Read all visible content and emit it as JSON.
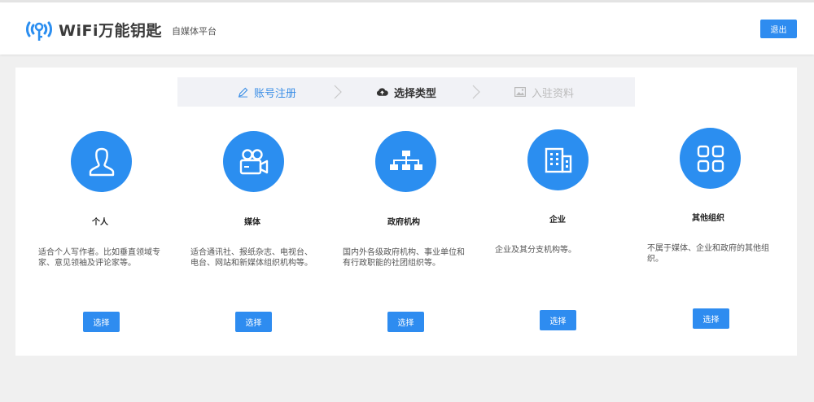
{
  "header": {
    "brand": "WiFi万能钥匙",
    "subtitle": "自媒体平台",
    "logout_label": "退出"
  },
  "steps": [
    {
      "label": "账号注册",
      "icon": "edit-icon",
      "state": "done"
    },
    {
      "label": "选择类型",
      "icon": "cloud-upload-icon",
      "state": "active"
    },
    {
      "label": "入驻资料",
      "icon": "image-icon",
      "state": "pending"
    }
  ],
  "types": [
    {
      "title": "个人",
      "icon": "user-icon",
      "desc": "适合个人写作者。比如垂直领域专家、意见领袖及评论家等。",
      "button": "选择"
    },
    {
      "title": "媒体",
      "icon": "video-camera-icon",
      "desc": "适合通讯社、报纸杂志、电视台、电台、网站和新媒体组织机构等。",
      "button": "选择"
    },
    {
      "title": "政府机构",
      "icon": "org-chart-icon",
      "desc": "国内外各级政府机构、事业单位和有行政职能的社团组织等。",
      "button": "选择"
    },
    {
      "title": "企业",
      "icon": "building-icon",
      "desc": "企业及其分支机构等。",
      "button": "选择"
    },
    {
      "title": "其他组织",
      "icon": "grid-icon",
      "desc": "不属于媒体、企业和政府的其他组织。",
      "button": "选择"
    }
  ],
  "colors": {
    "accent": "#2e8cf0",
    "circle": "#2b8ef0",
    "step_done": "#3a8ee6"
  }
}
